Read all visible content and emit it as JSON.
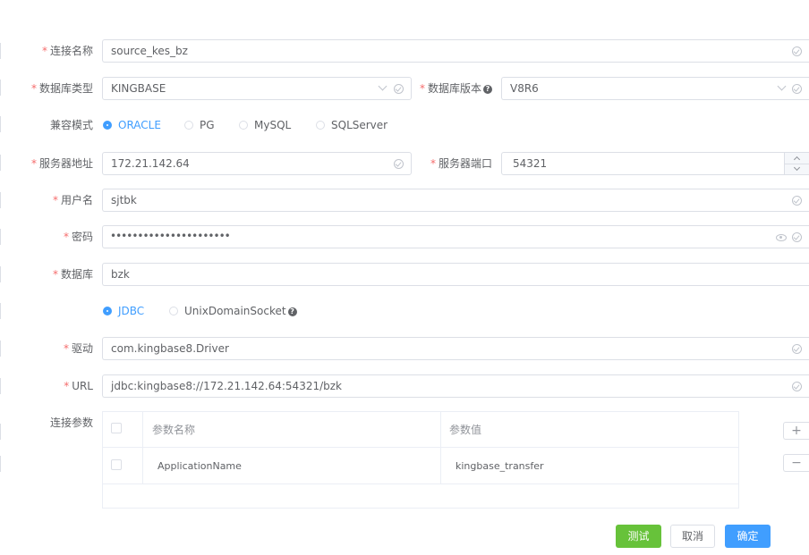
{
  "form": {
    "connection_name": {
      "label": "连接名称",
      "value": "source_kes_bz"
    },
    "db_type": {
      "label": "数据库类型",
      "value": "KINGBASE"
    },
    "db_version": {
      "label": "数据库版本",
      "value": "V8R6"
    },
    "compat_mode": {
      "label": "兼容模式",
      "options": [
        "ORACLE",
        "PG",
        "MySQL",
        "SQLServer"
      ],
      "selected": "ORACLE"
    },
    "server_address": {
      "label": "服务器地址",
      "value": "172.21.142.64"
    },
    "server_port": {
      "label": "服务器端口",
      "value": "54321"
    },
    "username": {
      "label": "用户名",
      "value": "sjtbk"
    },
    "password": {
      "label": "密码",
      "value": "••••••••••••••••••••••"
    },
    "database": {
      "label": "数据库",
      "value": "bzk"
    },
    "connect_type": {
      "options": [
        "JDBC",
        "UnixDomainSocket"
      ],
      "selected": "JDBC"
    },
    "driver": {
      "label": "驱动",
      "value": "com.kingbase8.Driver"
    },
    "url": {
      "label": "URL",
      "value": "jdbc:kingbase8://172.21.142.64:54321/bzk"
    },
    "params": {
      "label": "连接参数",
      "columns": [
        "参数名称",
        "参数值"
      ],
      "rows": [
        {
          "name": "ApplicationName",
          "value": "kingbase_transfer"
        }
      ],
      "add_label": "+",
      "remove_label": "−"
    }
  },
  "required_mark": "*",
  "help_mark": "?",
  "buttons": {
    "test": "测试",
    "cancel": "取消",
    "confirm": "确定"
  },
  "colors": {
    "primary": "#409eff",
    "success": "#67c23a",
    "required": "#f56c6c",
    "border": "#dcdfe6"
  }
}
